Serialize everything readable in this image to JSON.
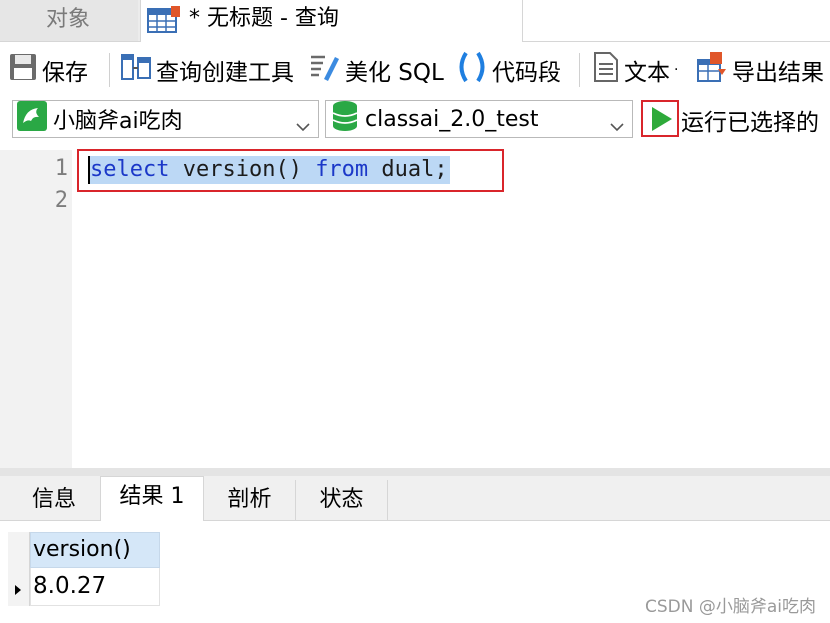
{
  "tabs": {
    "objects_label": "对象",
    "query_title": "* 无标题 - 查询"
  },
  "toolbar": {
    "save_label": "保存",
    "query_builder_label": "查询创建工具",
    "beautify_label": "美化 SQL",
    "snippet_label": "代码段",
    "text_label": "文本",
    "export_label": "导出结果"
  },
  "connection": {
    "connection_name": "小脑斧ai吃肉",
    "database_name": "classai_2.0_test",
    "run_selected_label": "运行已选择的"
  },
  "editor": {
    "line_numbers": [
      "1",
      "2"
    ],
    "tokens": [
      {
        "text": "select",
        "type": "keyword"
      },
      {
        "text": " version() ",
        "type": "plain"
      },
      {
        "text": "from",
        "type": "keyword"
      },
      {
        "text": " dual;",
        "type": "plain"
      }
    ]
  },
  "result_tabs": [
    "信息",
    "结果 1",
    "剖析",
    "状态"
  ],
  "active_result_tab": "结果 1",
  "results": {
    "columns": [
      "version()"
    ],
    "rows": [
      [
        "8.0.27"
      ]
    ]
  },
  "watermark": "CSDN @小脑斧ai吃肉",
  "colors": {
    "keyword": "#1b38c8",
    "selection": "#bcd8f5",
    "highlight_border": "#d9252b",
    "run_green": "#2eaa3a"
  }
}
